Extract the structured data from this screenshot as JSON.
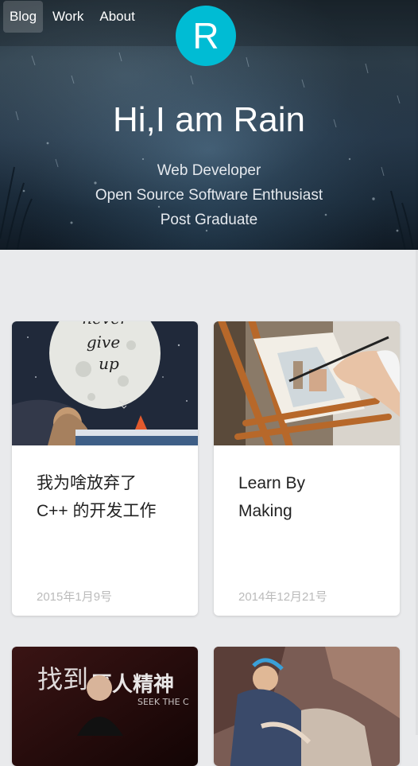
{
  "nav": {
    "items": [
      {
        "label": "Blog",
        "active": true
      },
      {
        "label": "Work"
      },
      {
        "label": "About"
      }
    ]
  },
  "avatar": {
    "letter": "R",
    "color": "#00bcd4"
  },
  "hero": {
    "title": "Hi,I am Rain",
    "subtitles": [
      "Web Developer",
      "Open Source Software Enthusiast",
      "Post Graduate"
    ]
  },
  "posts": [
    {
      "title_lines": [
        "我为啥放弃了",
        "C++ 的开发工作"
      ],
      "date": "2015年1月9号",
      "image": "moon-never-give-up-illustration",
      "image_text": [
        "never",
        "give",
        "up"
      ]
    },
    {
      "title_lines": [
        "Learn By",
        "Making"
      ],
      "date": "2014年12月21号",
      "image": "painting-on-easel-photo"
    },
    {
      "title_lines": [],
      "date": "",
      "image": "speaker-on-stage-photo",
      "image_text": [
        "找到",
        "匠人精神",
        "SEEK THE C"
      ]
    },
    {
      "title_lines": [],
      "date": "",
      "image": "impressionist-painting"
    }
  ]
}
